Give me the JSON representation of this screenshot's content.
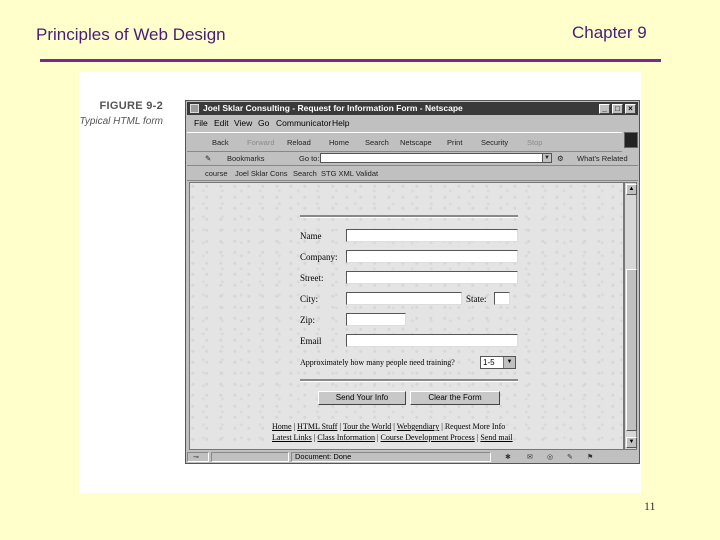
{
  "slide": {
    "title": "Principles of Web Design",
    "chapter": "Chapter 9",
    "page_number": "11",
    "accent_color": "#7a2a8c",
    "background_color": "#ffffcc"
  },
  "figure": {
    "number": "FIGURE 9-2",
    "caption": "Typical HTML form"
  },
  "browser": {
    "window_title": "Joel Sklar Consulting - Request for Information Form - Netscape",
    "menu": [
      "File",
      "Edit",
      "View",
      "Go",
      "Communicator",
      "Help"
    ],
    "toolbar": [
      "Back",
      "Forward",
      "Reload",
      "Home",
      "Search",
      "Netscape",
      "Print",
      "Security",
      "Stop"
    ],
    "bookmarks_label": "Bookmarks",
    "goto_label": "Go to:",
    "location_value": "",
    "whats_related": "What's Related",
    "personal_links": [
      "course",
      "Joel Sklar Cons",
      "Search",
      "STG XML Validat"
    ],
    "status_text": "Document: Done"
  },
  "form": {
    "labels": {
      "name": "Name",
      "company": "Company:",
      "street": "Street:",
      "city": "City:",
      "state": "State:",
      "zip": "Zip:",
      "email": "Email"
    },
    "training_question": "Approximately how many people need training?",
    "training_selected": "1-5",
    "submit_label": "Send Your Info",
    "reset_label": "Clear the Form"
  },
  "footer_links": {
    "row1": [
      "Home",
      "HTML Stuff",
      "Tour the World",
      "Webgendiary",
      "Request More Info"
    ],
    "row2": [
      "Latest Links",
      "Class Information",
      "Course Development Process",
      "Send mail"
    ]
  }
}
